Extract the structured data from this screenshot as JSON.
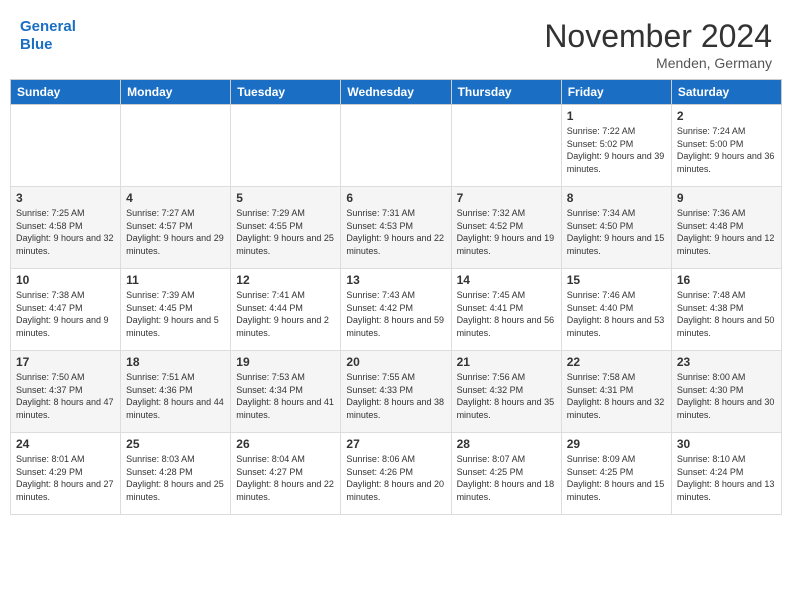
{
  "header": {
    "logo_line1": "General",
    "logo_line2": "Blue",
    "month_title": "November 2024",
    "location": "Menden, Germany"
  },
  "days_of_week": [
    "Sunday",
    "Monday",
    "Tuesday",
    "Wednesday",
    "Thursday",
    "Friday",
    "Saturday"
  ],
  "weeks": [
    [
      {
        "day": "",
        "info": ""
      },
      {
        "day": "",
        "info": ""
      },
      {
        "day": "",
        "info": ""
      },
      {
        "day": "",
        "info": ""
      },
      {
        "day": "",
        "info": ""
      },
      {
        "day": "1",
        "info": "Sunrise: 7:22 AM\nSunset: 5:02 PM\nDaylight: 9 hours and 39 minutes."
      },
      {
        "day": "2",
        "info": "Sunrise: 7:24 AM\nSunset: 5:00 PM\nDaylight: 9 hours and 36 minutes."
      }
    ],
    [
      {
        "day": "3",
        "info": "Sunrise: 7:25 AM\nSunset: 4:58 PM\nDaylight: 9 hours and 32 minutes."
      },
      {
        "day": "4",
        "info": "Sunrise: 7:27 AM\nSunset: 4:57 PM\nDaylight: 9 hours and 29 minutes."
      },
      {
        "day": "5",
        "info": "Sunrise: 7:29 AM\nSunset: 4:55 PM\nDaylight: 9 hours and 25 minutes."
      },
      {
        "day": "6",
        "info": "Sunrise: 7:31 AM\nSunset: 4:53 PM\nDaylight: 9 hours and 22 minutes."
      },
      {
        "day": "7",
        "info": "Sunrise: 7:32 AM\nSunset: 4:52 PM\nDaylight: 9 hours and 19 minutes."
      },
      {
        "day": "8",
        "info": "Sunrise: 7:34 AM\nSunset: 4:50 PM\nDaylight: 9 hours and 15 minutes."
      },
      {
        "day": "9",
        "info": "Sunrise: 7:36 AM\nSunset: 4:48 PM\nDaylight: 9 hours and 12 minutes."
      }
    ],
    [
      {
        "day": "10",
        "info": "Sunrise: 7:38 AM\nSunset: 4:47 PM\nDaylight: 9 hours and 9 minutes."
      },
      {
        "day": "11",
        "info": "Sunrise: 7:39 AM\nSunset: 4:45 PM\nDaylight: 9 hours and 5 minutes."
      },
      {
        "day": "12",
        "info": "Sunrise: 7:41 AM\nSunset: 4:44 PM\nDaylight: 9 hours and 2 minutes."
      },
      {
        "day": "13",
        "info": "Sunrise: 7:43 AM\nSunset: 4:42 PM\nDaylight: 8 hours and 59 minutes."
      },
      {
        "day": "14",
        "info": "Sunrise: 7:45 AM\nSunset: 4:41 PM\nDaylight: 8 hours and 56 minutes."
      },
      {
        "day": "15",
        "info": "Sunrise: 7:46 AM\nSunset: 4:40 PM\nDaylight: 8 hours and 53 minutes."
      },
      {
        "day": "16",
        "info": "Sunrise: 7:48 AM\nSunset: 4:38 PM\nDaylight: 8 hours and 50 minutes."
      }
    ],
    [
      {
        "day": "17",
        "info": "Sunrise: 7:50 AM\nSunset: 4:37 PM\nDaylight: 8 hours and 47 minutes."
      },
      {
        "day": "18",
        "info": "Sunrise: 7:51 AM\nSunset: 4:36 PM\nDaylight: 8 hours and 44 minutes."
      },
      {
        "day": "19",
        "info": "Sunrise: 7:53 AM\nSunset: 4:34 PM\nDaylight: 8 hours and 41 minutes."
      },
      {
        "day": "20",
        "info": "Sunrise: 7:55 AM\nSunset: 4:33 PM\nDaylight: 8 hours and 38 minutes."
      },
      {
        "day": "21",
        "info": "Sunrise: 7:56 AM\nSunset: 4:32 PM\nDaylight: 8 hours and 35 minutes."
      },
      {
        "day": "22",
        "info": "Sunrise: 7:58 AM\nSunset: 4:31 PM\nDaylight: 8 hours and 32 minutes."
      },
      {
        "day": "23",
        "info": "Sunrise: 8:00 AM\nSunset: 4:30 PM\nDaylight: 8 hours and 30 minutes."
      }
    ],
    [
      {
        "day": "24",
        "info": "Sunrise: 8:01 AM\nSunset: 4:29 PM\nDaylight: 8 hours and 27 minutes."
      },
      {
        "day": "25",
        "info": "Sunrise: 8:03 AM\nSunset: 4:28 PM\nDaylight: 8 hours and 25 minutes."
      },
      {
        "day": "26",
        "info": "Sunrise: 8:04 AM\nSunset: 4:27 PM\nDaylight: 8 hours and 22 minutes."
      },
      {
        "day": "27",
        "info": "Sunrise: 8:06 AM\nSunset: 4:26 PM\nDaylight: 8 hours and 20 minutes."
      },
      {
        "day": "28",
        "info": "Sunrise: 8:07 AM\nSunset: 4:25 PM\nDaylight: 8 hours and 18 minutes."
      },
      {
        "day": "29",
        "info": "Sunrise: 8:09 AM\nSunset: 4:25 PM\nDaylight: 8 hours and 15 minutes."
      },
      {
        "day": "30",
        "info": "Sunrise: 8:10 AM\nSunset: 4:24 PM\nDaylight: 8 hours and 13 minutes."
      }
    ]
  ]
}
